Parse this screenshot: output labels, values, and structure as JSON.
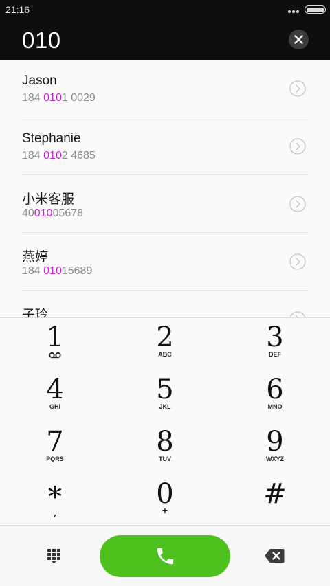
{
  "status_bar": {
    "time": "21:16"
  },
  "dialer": {
    "input_value": "010"
  },
  "results": [
    {
      "name": "Jason",
      "number_parts": [
        "184 ",
        "010",
        "1 0029"
      ]
    },
    {
      "name": "Stephanie",
      "number_parts": [
        "184 ",
        "010",
        "2 4685"
      ]
    },
    {
      "name": "小米客服",
      "number_parts": [
        "40",
        "010",
        "05678"
      ]
    },
    {
      "name": "燕婷",
      "number_parts": [
        "184 ",
        "010",
        "15689"
      ]
    },
    {
      "name": "子玲",
      "number_parts": [
        "",
        "",
        ""
      ]
    }
  ],
  "keypad": [
    {
      "digit": "1",
      "letters": ""
    },
    {
      "digit": "2",
      "letters": "ABC"
    },
    {
      "digit": "3",
      "letters": "DEF"
    },
    {
      "digit": "4",
      "letters": "GHI"
    },
    {
      "digit": "5",
      "letters": "JKL"
    },
    {
      "digit": "6",
      "letters": "MNO"
    },
    {
      "digit": "7",
      "letters": "PQRS"
    },
    {
      "digit": "8",
      "letters": "TUV"
    },
    {
      "digit": "9",
      "letters": "WXYZ"
    },
    {
      "digit": "*",
      "letters": ","
    },
    {
      "digit": "0",
      "letters": "+"
    },
    {
      "digit": "#",
      "letters": ""
    }
  ],
  "colors": {
    "match_highlight": "#cc1fd1",
    "call_green": "#4fc11f",
    "header_bg": "#0e0e0e"
  },
  "icons": {
    "clear": "close-icon",
    "row_detail": "chevron-right-icon",
    "keypad_toggle": "keypad-icon",
    "call": "phone-icon",
    "delete": "backspace-icon",
    "voicemail": "voicemail-icon"
  }
}
